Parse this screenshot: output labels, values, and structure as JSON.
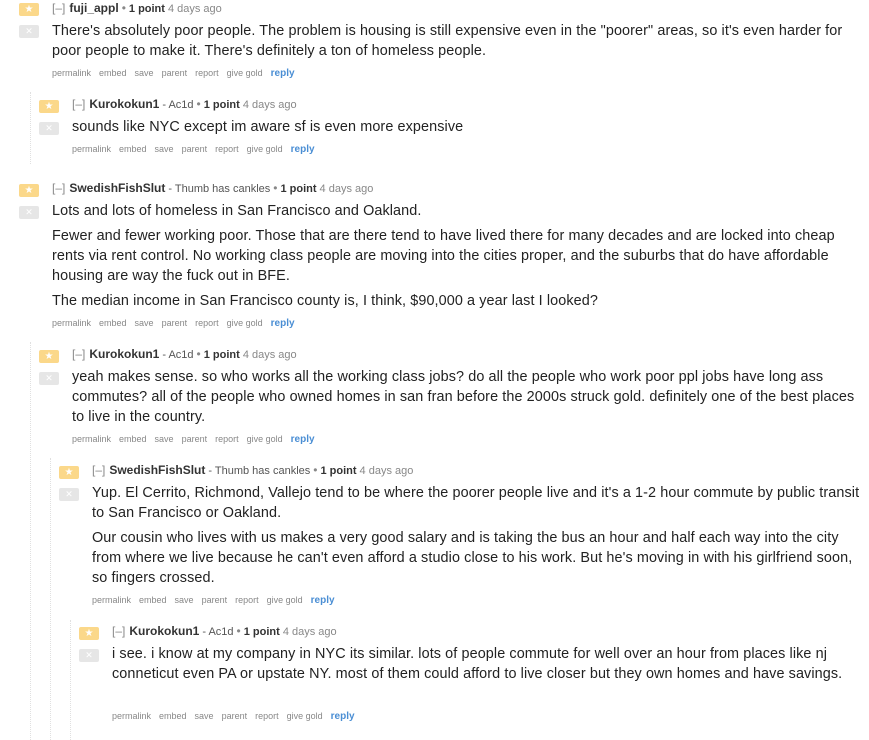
{
  "colors": {
    "upvote": "#fbd88a",
    "downvote": "#e6e6e6",
    "reply_link": "#4a8ed4"
  },
  "icons": {
    "upvote": "star-icon",
    "downvote": "x-icon"
  },
  "comments": [
    {
      "collapse": "[–]",
      "author": "fuji_appl",
      "flair": "",
      "score": "1 point",
      "time": "4 days ago",
      "paragraphs": [
        "There's absolutely poor people. The problem is housing is still expensive even in the \"poorer\" areas, so it's even harder for poor people to make it. There's definitely a ton of homeless people."
      ]
    },
    {
      "collapse": "[–]",
      "author": "Kurokokun1",
      "flair": "- Ac1d",
      "score": "1 point",
      "time": "4 days ago",
      "paragraphs": [
        "sounds like NYC except im aware sf is even more expensive"
      ]
    },
    {
      "collapse": "[–]",
      "author": "SwedishFishSlut",
      "flair": "- Thumb has cankles",
      "score": "1 point",
      "time": "4 days ago",
      "paragraphs": [
        "Lots and lots of homeless in San Francisco and Oakland.",
        "Fewer and fewer working poor. Those that are there tend to have lived there for many decades and are locked into cheap rents via rent control. No working class people are moving into the cities proper, and the suburbs that do have affordable housing are way the fuck out in BFE.",
        "The median income in San Francisco county is, I think, $90,000 a year last I looked?"
      ]
    },
    {
      "collapse": "[–]",
      "author": "Kurokokun1",
      "flair": "- Ac1d",
      "score": "1 point",
      "time": "4 days ago",
      "paragraphs": [
        "yeah makes sense. so who works all the working class jobs? do all the people who work poor ppl jobs have long ass commutes? all of the people who owned homes in san fran before the 2000s struck gold. definitely one of the best places to live in the country."
      ]
    },
    {
      "collapse": "[–]",
      "author": "SwedishFishSlut",
      "flair": "- Thumb has cankles",
      "score": "1 point",
      "time": "4 days ago",
      "paragraphs": [
        "Yup. El Cerrito, Richmond, Vallejo tend to be where the poorer people live and it's a 1-2 hour commute by public transit to San Francisco or Oakland.",
        "Our cousin who lives with us makes a very good salary and is taking the bus an hour and half each way into the city from where we live because he can't even afford a studio close to his work. But he's moving in with his girlfriend soon, so fingers crossed."
      ]
    },
    {
      "collapse": "[–]",
      "author": "Kurokokun1",
      "flair": "- Ac1d",
      "score": "1 point",
      "time": "4 days ago",
      "paragraphs": [
        "i see. i know at my company in NYC its similar. lots of people commute for well over an hour from places like nj conneticut even PA or upstate NY. most of them could afford to live closer but they own homes and have savings."
      ]
    }
  ],
  "buttons": {
    "permalink": "permalink",
    "embed": "embed",
    "save": "save",
    "parent": "parent",
    "report": "report",
    "give_gold": "give gold",
    "reply": "reply"
  }
}
